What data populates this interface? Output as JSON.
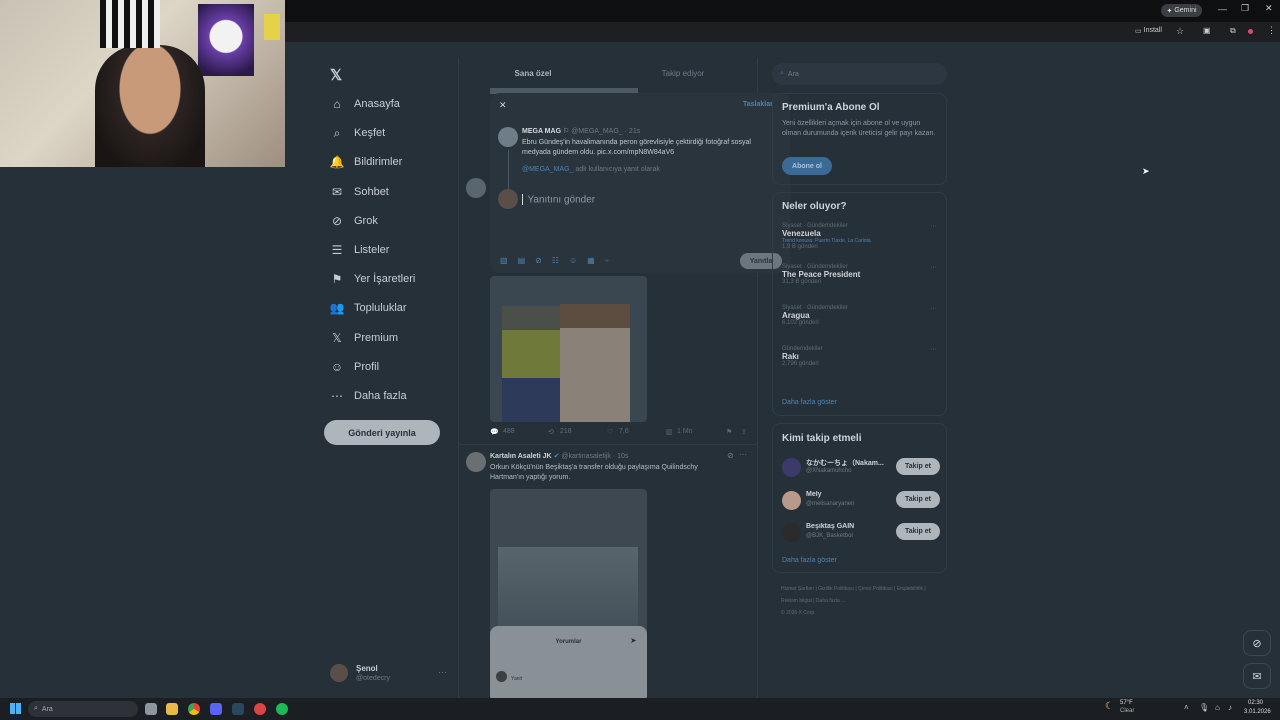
{
  "browser": {
    "gemini_label": "Gemini",
    "install_label": "Install"
  },
  "sidebar": {
    "items": [
      {
        "label": "Anasayfa",
        "icon": "home-icon"
      },
      {
        "label": "Keşfet",
        "icon": "search-icon"
      },
      {
        "label": "Bildirimler",
        "icon": "bell-icon"
      },
      {
        "label": "Sohbet",
        "icon": "mail-icon"
      },
      {
        "label": "Grok",
        "icon": "grok-icon"
      },
      {
        "label": "Listeler",
        "icon": "list-icon"
      },
      {
        "label": "Yer İşaretleri",
        "icon": "bookmark-icon"
      },
      {
        "label": "Topluluklar",
        "icon": "people-icon"
      },
      {
        "label": "Premium",
        "icon": "x-logo-icon"
      },
      {
        "label": "Profil",
        "icon": "person-icon"
      },
      {
        "label": "Daha fazla",
        "icon": "more-circle-icon"
      }
    ],
    "post_button": "Gönderi yayınla",
    "account": {
      "name": "Şenol",
      "handle": "@otedecry"
    }
  },
  "feed": {
    "tabs": [
      "Sana özel",
      "Takip ediyor"
    ],
    "stats": {
      "replies": "488",
      "reposts": "218",
      "likes": "7,6",
      "views": "1 Mn"
    },
    "tweet2": {
      "author": "Kartalın Asaleti JK",
      "handle": "@kartinasaletijk",
      "time": "10s",
      "text": "Orkun Kökçü'nün Beşiktaş'a transfer olduğu paylaşıma Quilindschy Hartman'ın yaptığı yorum.",
      "embedded_title": "Yorumlar",
      "embedded_user": "Yanit"
    }
  },
  "modal": {
    "drafts_label": "Taslaklar",
    "quoted": {
      "author": "MEGA MAG",
      "handle": "@MEGA_MAG_",
      "time": "21s",
      "text": "Ebru Gündeş'in havalimanında peron görevlisiyle çektirdiği fotoğraf sosyal medyada gündem oldu. pic.x.com/mpN8W84aV6"
    },
    "reply_to_handle": "@MEGA_MAG_",
    "reply_to_suffix": "adlı kullanıcıya yanıt olarak",
    "reply_placeholder": "Yanıtını gönder",
    "submit_label": "Yanıtla"
  },
  "right": {
    "search_placeholder": "Ara",
    "premium": {
      "title": "Premium'a Abone Ol",
      "text": "Yeni özellikleri açmak için abone ol ve uygun olman durumunda içerik üreticisi gelir payı kazan.",
      "button": "Abone ol"
    },
    "trends": {
      "title": "Neler oluyor?",
      "items": [
        {
          "meta": "Siyaset · Gündemdekiler",
          "title": "Venezuela",
          "sub": "Trend konusu: Puerto Tlaxte, La Carlota",
          "count": "1,9 B gönderi"
        },
        {
          "meta": "Siyaset · Gündemdekiler",
          "title": "The Peace President",
          "sub": "",
          "count": "31,3 B gönderi"
        },
        {
          "meta": "Siyaset · Gündemdekiler",
          "title": "Aragua",
          "sub": "",
          "count": "6.102 gönderi"
        },
        {
          "meta": "Gündemdekiler",
          "title": "Rakı",
          "sub": "",
          "count": "2.796 gönderi"
        }
      ],
      "show_more": "Daha fazla göster"
    },
    "follow": {
      "title": "Kimi takip etmeli",
      "items": [
        {
          "name": "なかむーちょ（Nakam...",
          "handle": "@XNakamuhcho",
          "button": "Takip et"
        },
        {
          "name": "Mely",
          "handle": "@melisanaryanen",
          "button": "Takip et"
        },
        {
          "name": "Beşiktaş GAİN",
          "handle": "@BJK_Basketbol",
          "button": "Takip et"
        }
      ],
      "show_more": "Daha fazla göster"
    },
    "footer": {
      "links": [
        "Hizmet Şartları",
        "Gizlilik Politikası",
        "Çerez Politikası",
        "Erişilebilirlik",
        "Reklam bilgisi",
        "Daha fazla ..."
      ],
      "copyright": "© 2026 X Corp."
    }
  },
  "taskbar": {
    "search_placeholder": "Ara",
    "weather_temp": "57°F",
    "weather_desc": "Clear",
    "time": "02:30",
    "date": "3.01.2026"
  }
}
